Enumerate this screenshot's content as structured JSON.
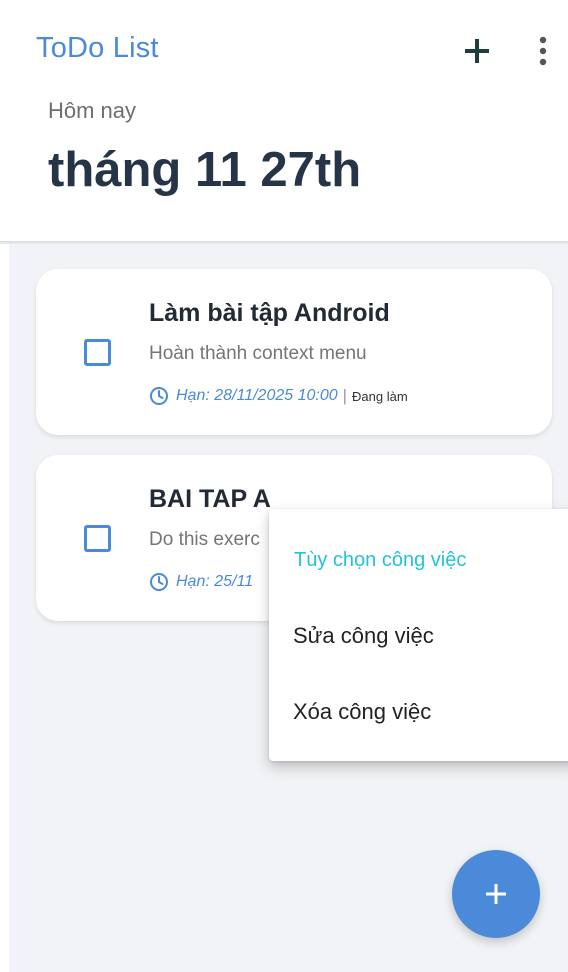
{
  "appbar": {
    "title": "ToDo List",
    "add_icon": "plus-icon",
    "more_icon": "more-vert-icon"
  },
  "header": {
    "today_label": "Hôm nay",
    "date_title": "tháng 11 27th"
  },
  "tasks": [
    {
      "title": "Làm bài tập Android",
      "description": "Hoàn thành context menu",
      "due": "Hạn: 28/11/2025 10:00",
      "separator": "|",
      "status": "Đang làm",
      "checked": false
    },
    {
      "title": "BAI TAP A",
      "description": "Do this exerc",
      "due": "Hạn: 25/11",
      "checked": false
    }
  ],
  "context_menu": {
    "header": "Tùy chọn công việc",
    "items": [
      "Sửa công việc",
      "Xóa công việc"
    ]
  },
  "fab": {
    "icon": "plus-icon"
  },
  "colors": {
    "accent": "#4a8ad8",
    "menu_header": "#23c2df",
    "background": "#f1f3f6",
    "title_dark": "#263447"
  }
}
